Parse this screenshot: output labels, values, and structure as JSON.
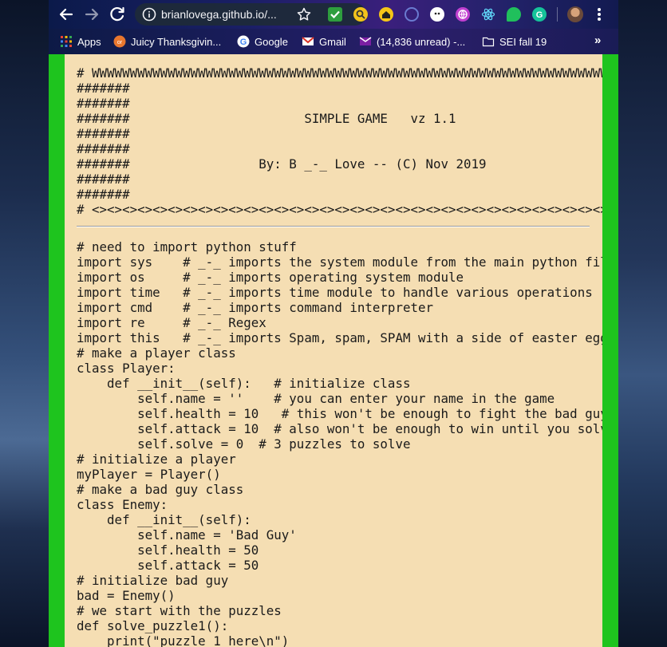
{
  "toolbar": {
    "url": "brianlovega.github.io/...",
    "extensions": [
      "checkmark-extension-icon",
      "magnifier-extension-icon",
      "home-extension-icon",
      "github-extension-icon",
      "ghost-extension-icon",
      "web-extension-icon",
      "react-devtools-icon",
      "evernote-icon",
      "grammarly-icon"
    ]
  },
  "bookmarks": [
    {
      "label": "Apps",
      "icon": "apps-grid-icon"
    },
    {
      "label": "Juicy Thanksgivin...",
      "icon": "orange-circle-icon"
    },
    {
      "label": "Google",
      "icon": "google-icon"
    },
    {
      "label": "Gmail",
      "icon": "gmail-icon"
    },
    {
      "label": "(14,836 unread) -...",
      "icon": "yahoo-mail-icon"
    },
    {
      "label": "SEI fall 19",
      "icon": "folder-icon"
    }
  ],
  "colors": {
    "page_green": "#1ec41e",
    "panel_wheat": "#f5deb3"
  },
  "header_block": [
    "# WWWWWWWWWWWWWWWWWWWWWWWWWWWWWWWWWWWWWWWWWWWWWWWWWWWWWWWWWWWWWWWWWWWWWWWWWWWWWWW",
    "#######",
    "#######",
    "#######                       SIMPLE GAME   vz 1.1",
    "#######",
    "#######",
    "#######                 By: B _-_ Love -- (C) Nov 2019",
    "#######",
    "#######",
    "# <><><><><><><><><><><><><><><><><><><><><><><><><><><><><><><><><><><><><><><><><>"
  ],
  "code_block": [
    "# need to import python stuff",
    "import sys    # _-_ imports the system module from the main python file",
    "import os     # _-_ imports operating system module",
    "import time   # _-_ imports time module to handle various operations re",
    "import cmd    # _-_ imports command interpreter",
    "import re     # _-_ Regex",
    "import this   # _-_ imports Spam, spam, SPAM with a side of easter eggs",
    "# make a player class",
    "class Player:",
    "    def __init__(self):   # initialize class",
    "        self.name = ''    # you can enter your name in the game",
    "        self.health = 10   # this won't be enough to fight the bad guy",
    "        self.attack = 10  # also won't be enough to win until you solve",
    "        self.solve = 0  # 3 puzzles to solve",
    "# initialize a player",
    "myPlayer = Player()",
    "# make a bad guy class",
    "class Enemy:",
    "    def __init__(self):",
    "        self.name = 'Bad Guy'",
    "        self.health = 50",
    "        self.attack = 50",
    "# initialize bad guy",
    "bad = Enemy()",
    "# we start with the puzzles",
    "def solve_puzzle1():",
    "    print(\"puzzle 1 here\\n\")"
  ]
}
